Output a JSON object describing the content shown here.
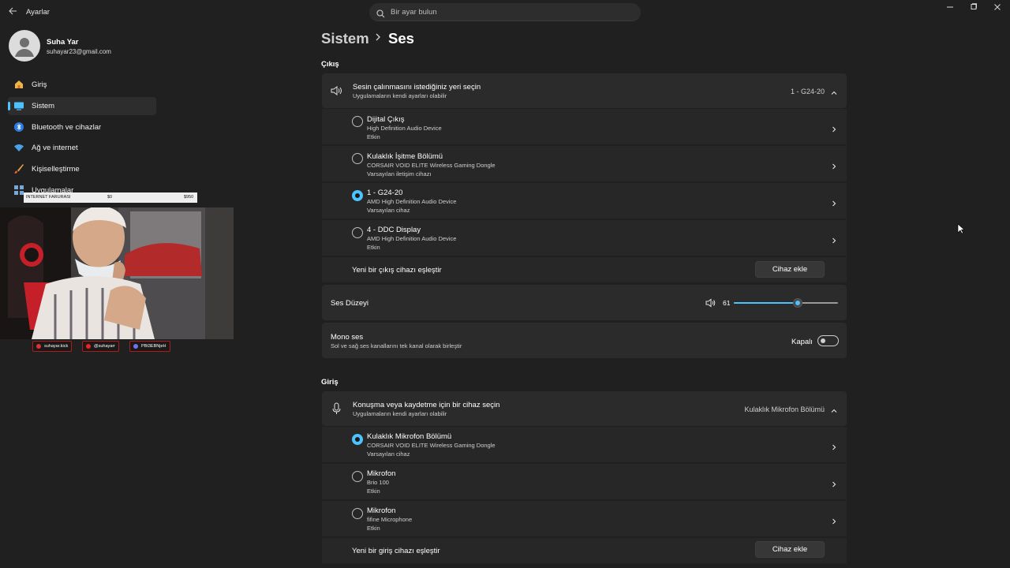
{
  "app": {
    "title": "Ayarlar"
  },
  "search": {
    "placeholder": "Bir ayar bulun"
  },
  "profile": {
    "name": "Suha Yar",
    "email": "suhayar23@gmail.com"
  },
  "sidebar": {
    "items": [
      {
        "label": "Giriş",
        "icon": "home-icon"
      },
      {
        "label": "Sistem",
        "icon": "system-icon",
        "active": true
      },
      {
        "label": "Bluetooth ve cihazlar",
        "icon": "bluetooth-icon"
      },
      {
        "label": "Ağ ve internet",
        "icon": "wifi-icon"
      },
      {
        "label": "Kişiselleştirme",
        "icon": "brush-icon"
      },
      {
        "label": "Uygulamalar",
        "icon": "apps-icon"
      }
    ]
  },
  "overlay": {
    "bar_label": "INTERNET FARURASI",
    "bar_min": "$0",
    "bar_max": "$950",
    "socials": [
      "suhayar.kick",
      "@suhayarr",
      "PBt3EBNjeH"
    ]
  },
  "breadcrumb": {
    "parent": "Sistem",
    "current": "Ses"
  },
  "output": {
    "heading": "Çıkış",
    "selector": {
      "title": "Sesin çalınmasını istediğiniz yeri seçin",
      "subtitle": "Uygulamaların kendi ayarları olabilir",
      "selected": "1 - G24-20"
    },
    "devices": [
      {
        "name": "Dijital Çıkış",
        "driver": "High Definition Audio Device",
        "status": "Etkin",
        "selected": false
      },
      {
        "name": "Kulaklık İşitme Bölümü",
        "driver": "CORSAIR VOID ELITE Wireless Gaming Dongle",
        "status": "Varsayılan iletişim cihazı",
        "selected": false
      },
      {
        "name": "1 - G24-20",
        "driver": "AMD High Definition Audio Device",
        "status": "Varsayılan cihaz",
        "selected": true
      },
      {
        "name": "4 - DDC Display",
        "driver": "AMD High Definition Audio Device",
        "status": "Etkin",
        "selected": false
      }
    ],
    "pair_label": "Yeni bir çıkış cihazı eşleştir",
    "add_button": "Cihaz ekle",
    "volume": {
      "label": "Ses Düzeyi",
      "value": "61",
      "fraction": 0.61
    },
    "mono": {
      "title": "Mono ses",
      "subtitle": "Sol ve sağ ses kanallarını tek kanal olarak birleştir",
      "state": "Kapalı"
    }
  },
  "input": {
    "heading": "Giriş",
    "selector": {
      "title": "Konuşma veya kaydetme için bir cihaz seçin",
      "subtitle": "Uygulamaların kendi ayarları olabilir",
      "selected": "Kulaklık Mikrofon Bölümü"
    },
    "devices": [
      {
        "name": "Kulaklık Mikrofon Bölümü",
        "driver": "CORSAIR VOID ELITE Wireless Gaming Dongle",
        "status": "Varsayılan cihaz",
        "selected": true
      },
      {
        "name": "Mikrofon",
        "driver": "Brio 100",
        "status": "Etkin",
        "selected": false
      },
      {
        "name": "Mikrofon",
        "driver": "fifine Microphone",
        "status": "Etkin",
        "selected": false
      }
    ],
    "pair_label": "Yeni bir giriş cihazı eşleştir",
    "add_button": "Cihaz ekle"
  },
  "colors": {
    "background": "#202020",
    "card": "#2b2b2b",
    "accent": "#4cc2ff"
  }
}
